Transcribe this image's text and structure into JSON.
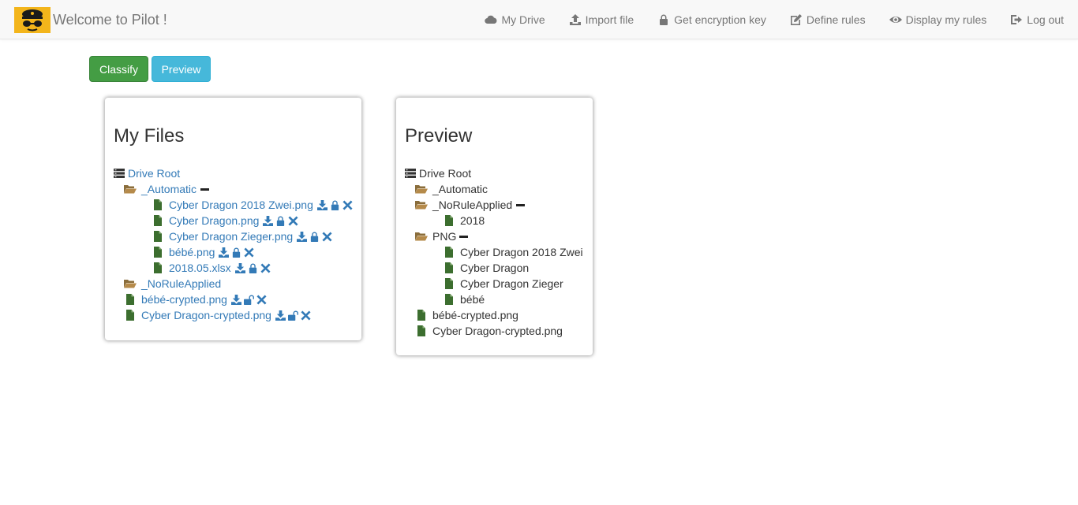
{
  "header": {
    "brand_title": "Welcome to Pilot !",
    "nav": {
      "my_drive": "My Drive",
      "import_file": "Import file",
      "encryption_key": "Get encryption key",
      "define_rules": "Define rules",
      "display_rules": "Display my rules",
      "log_out": "Log out"
    }
  },
  "actions": {
    "classify": "Classify",
    "preview": "Preview"
  },
  "files_panel": {
    "title": "My Files",
    "root": "Drive Root",
    "folder_automatic": "_Automatic",
    "auto_files": [
      "Cyber Dragon 2018 Zwei.png",
      "Cyber Dragon.png",
      "Cyber Dragon Zieger.png",
      "bébé.png",
      "2018.05.xlsx"
    ],
    "folder_norule": "_NoRuleApplied",
    "root_files": [
      "bébé-crypted.png",
      "Cyber Dragon-crypted.png"
    ]
  },
  "preview_panel": {
    "title": "Preview",
    "root": "Drive Root",
    "folder_automatic": "_Automatic",
    "folder_norule": "_NoRuleApplied",
    "norule_files": [
      "2018"
    ],
    "folder_png": "PNG",
    "png_files": [
      "Cyber Dragon 2018 Zwei",
      "Cyber Dragon",
      "Cyber Dragon Zieger",
      "bébé"
    ],
    "root_files": [
      "bébé-crypted.png",
      "Cyber Dragon-crypted.png"
    ]
  },
  "colors": {
    "link": "#337ab7",
    "file_icon": "#3c6e2f",
    "folder_icon": "#8a6d3b",
    "classify": "#449d44",
    "preview": "#46b8da"
  }
}
